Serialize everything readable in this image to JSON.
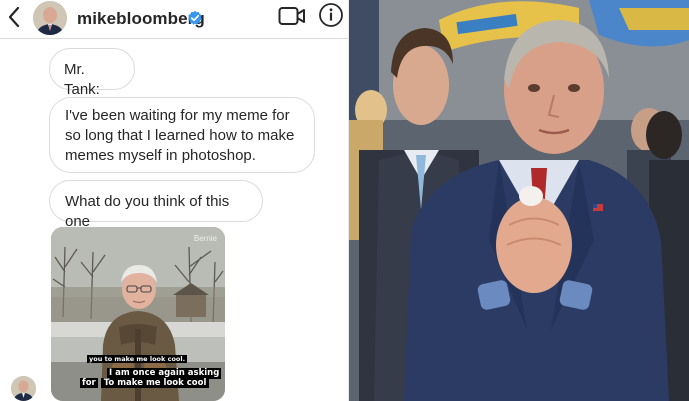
{
  "header": {
    "back_icon": "chevron-left-icon",
    "avatar_icon": "profile-avatar",
    "username": "mikebloomberg",
    "verified_icon": "verified-badge-icon",
    "video_icon": "video-call-icon",
    "info_icon": "info-icon",
    "colors": {
      "verified": "#3897f0",
      "text": "#262626",
      "border": "#dbdbdb"
    }
  },
  "messages": [
    {
      "text": "Mr. Tank:"
    },
    {
      "text": "I've been waiting for my meme for so long that I learned how to make memes myself in photoshop."
    },
    {
      "text": "What do you think of this one"
    }
  ],
  "meme": {
    "watermark": "Bernie",
    "caption_small": "you to make me look cool.",
    "caption_main": "I am once again asking",
    "caption_line2_a": "for",
    "caption_line2_b": "To make me look cool"
  }
}
